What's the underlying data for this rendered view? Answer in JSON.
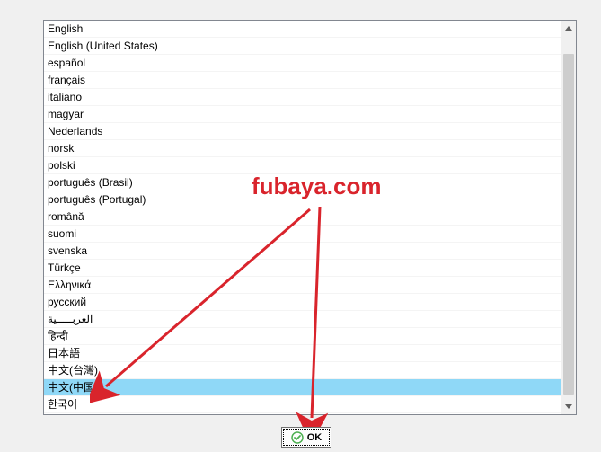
{
  "languages": [
    "English",
    "English (United States)",
    "español",
    "français",
    "italiano",
    "magyar",
    "Nederlands",
    "norsk",
    "polski",
    "português (Brasil)",
    "português (Portugal)",
    "română",
    "suomi",
    "svenska",
    "Türkçe",
    "Ελληνικά",
    "русский",
    "العربـــــية",
    "हिन्दी",
    "日本語",
    "中文(台灣)",
    "中文(中国)",
    "한국어"
  ],
  "selected_index": 21,
  "buttons": {
    "ok_label": "OK"
  },
  "watermark_text": "fubaya.com",
  "scrollbar": {
    "thumb_top_pct": 5,
    "thumb_height_pct": 94
  }
}
